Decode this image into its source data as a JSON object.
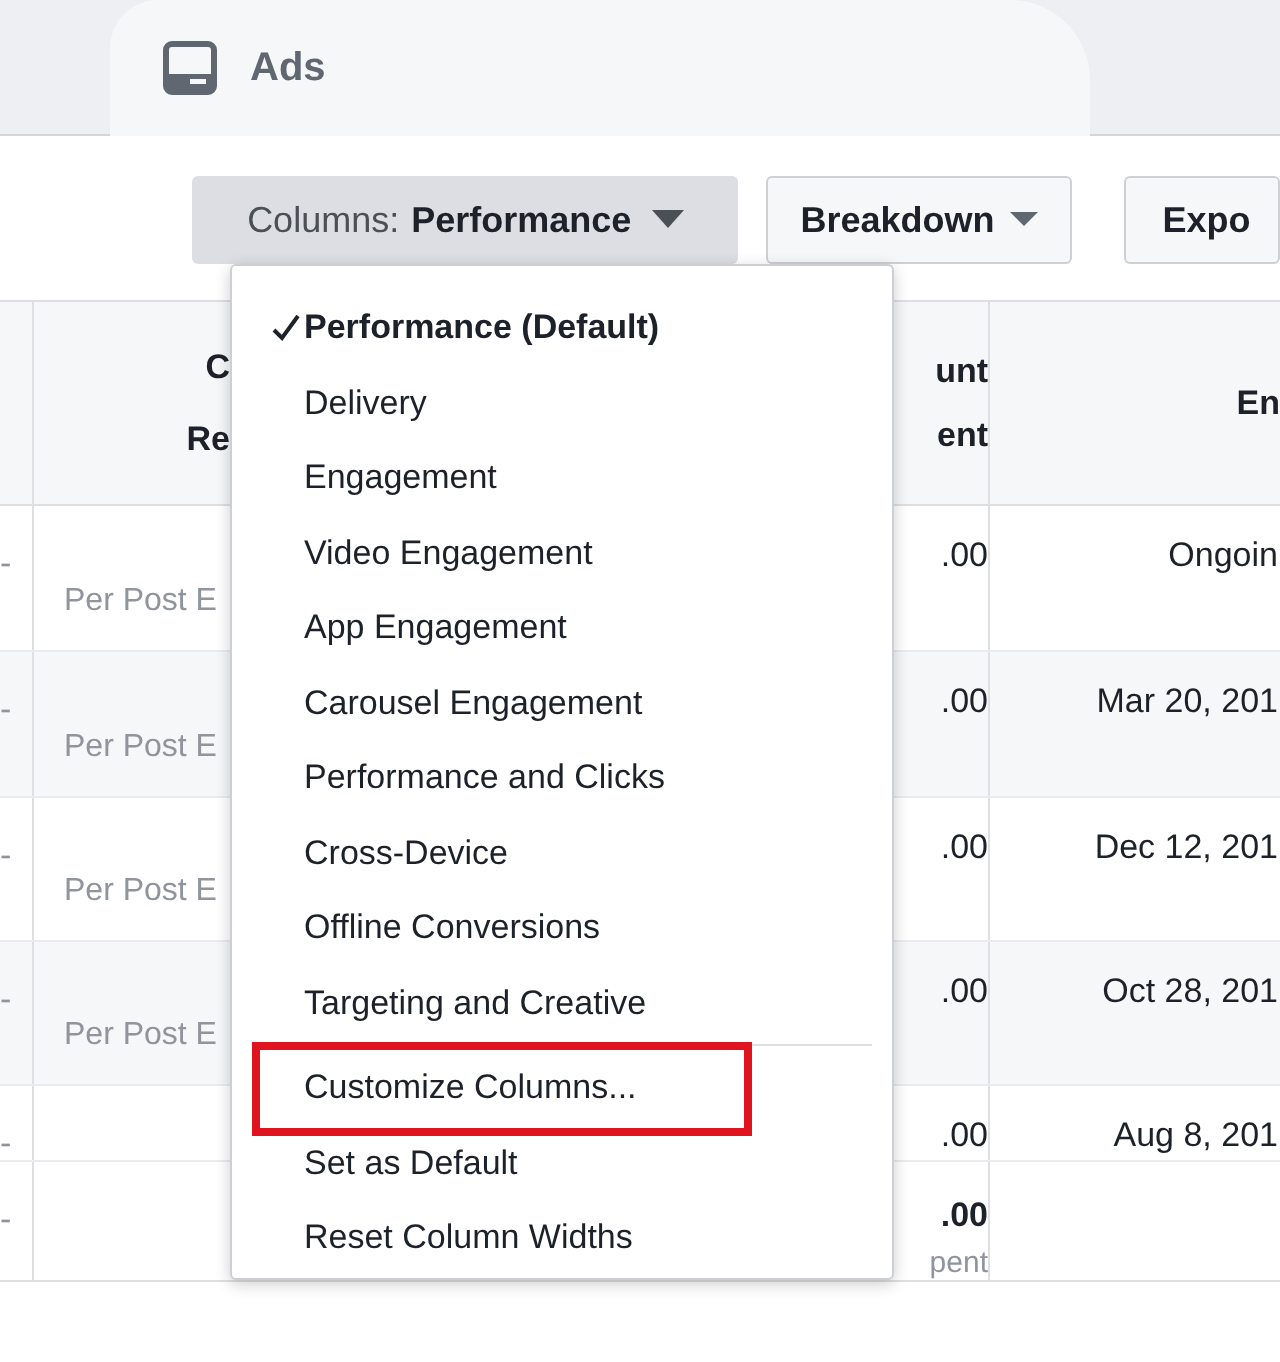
{
  "tab": {
    "label": "Ads"
  },
  "toolbar": {
    "columns_button": {
      "prefix": "Columns:",
      "value": "Performance"
    },
    "breakdown_button": "Breakdown",
    "export_button": "Expo"
  },
  "table": {
    "header": {
      "column_1": [
        "C",
        "Re"
      ],
      "column_2": [
        "unt",
        "ent"
      ],
      "column_3": "En"
    },
    "rows": [
      {
        "column_0": "-",
        "column_1": "Per Post E",
        "column_2": ".00",
        "column_3": "Ongoin"
      },
      {
        "column_0": "-",
        "column_1": "Per Post E",
        "column_2": ".00",
        "column_3": "Mar 20, 201"
      },
      {
        "column_0": "-",
        "column_1": "Per Post E",
        "column_2": ".00",
        "column_3": "Dec 12, 201"
      },
      {
        "column_0": "-",
        "column_1": "Per Post E",
        "column_2": ".00",
        "column_3": "Oct 28, 201"
      },
      {
        "column_0": "-",
        "column_2": ".00",
        "column_3": "Aug 8, 201"
      }
    ],
    "footer": {
      "column_0": "-",
      "column_2": [
        ".00",
        "pent"
      ]
    }
  },
  "menu": {
    "views": [
      {
        "label": "Performance (Default)",
        "selected": true
      },
      {
        "label": "Delivery",
        "selected": false
      },
      {
        "label": "Engagement",
        "selected": false
      },
      {
        "label": "Video Engagement",
        "selected": false
      },
      {
        "label": "App Engagement",
        "selected": false
      },
      {
        "label": "Carousel Engagement",
        "selected": false
      },
      {
        "label": "Performance and Clicks",
        "selected": false
      },
      {
        "label": "Cross-Device",
        "selected": false
      },
      {
        "label": "Offline Conversions",
        "selected": false
      },
      {
        "label": "Targeting and Creative",
        "selected": false
      }
    ],
    "actions": [
      {
        "label": "Customize Columns...",
        "highlighted": true
      },
      {
        "label": "Set as Default",
        "highlighted": false
      },
      {
        "label": "Reset Column Widths",
        "highlighted": false
      }
    ]
  }
}
